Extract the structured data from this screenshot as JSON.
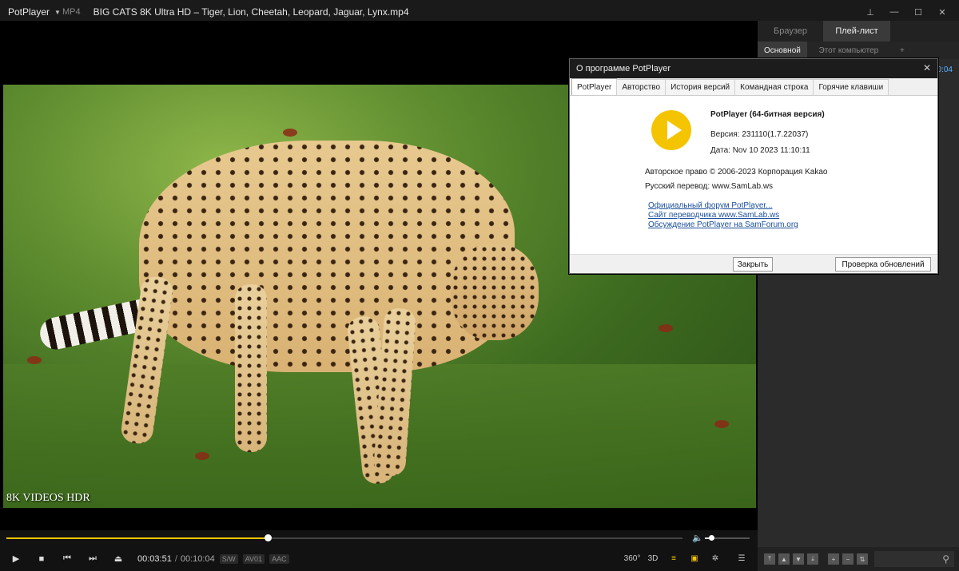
{
  "titlebar": {
    "app_name": "PotPlayer",
    "format": "MP4",
    "filename": "BIG CATS 8K Ultra HD – Tiger, Lion, Cheetah, Leopard, Jaguar, Lynx.mp4"
  },
  "video": {
    "watermark": "8K VIDEOS HDR"
  },
  "playback": {
    "progress_fraction": 0.387,
    "volume_fraction": 0.14,
    "current_time": "00:03:51",
    "separator": "/",
    "total_time": "00:10:04",
    "tags": [
      "S/W",
      "AV01",
      "AAC"
    ]
  },
  "right_controls": {
    "vr": "360°",
    "threed": "3D"
  },
  "panel": {
    "tabs": [
      "Браузер",
      "Плей-лист"
    ],
    "subtabs": [
      "Основной",
      "Этот компьютер",
      "+"
    ],
    "time_fragment": "0:04"
  },
  "dialog": {
    "title": "О программе PotPlayer",
    "tabs": [
      "PotPlayer",
      "Авторство",
      "История версий",
      "Командная строка",
      "Горячие клавиши"
    ],
    "product": "PotPlayer (64-битная версия)",
    "version": "Версия: 231110(1.7.22037)",
    "date": "Дата: Nov 10 2023 11:10:11",
    "copyright": "Авторское право © 2006-2023 Корпорация Kakao",
    "translation": "Русский перевод: www.SamLab.ws",
    "links": [
      "Официальный форум PotPlayer...",
      "Сайт переводчика www.SamLab.ws",
      "Обсуждение PotPlayer на SamForum.org"
    ],
    "close_button": "Закрыть",
    "update_button": "Проверка обновлений"
  }
}
